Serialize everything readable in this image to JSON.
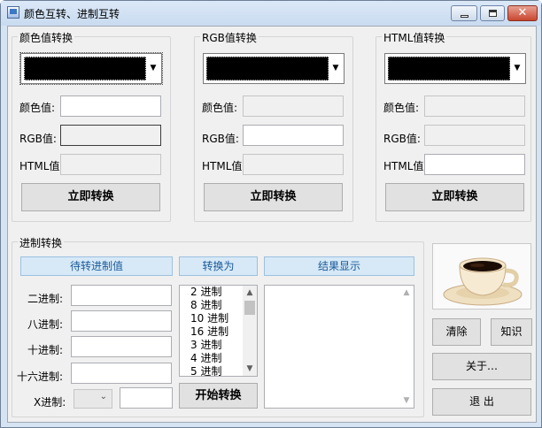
{
  "window": {
    "title": "颜色互转、进制互转",
    "controls": {
      "close": "✕"
    }
  },
  "color_groups": [
    {
      "title": "颜色值转换",
      "swatch_color": "#000000",
      "fields": [
        {
          "label": "颜色值:",
          "value": ""
        },
        {
          "label": "RGB值:",
          "value": ""
        },
        {
          "label": "HTML值:",
          "value": ""
        }
      ],
      "button": "立即转换"
    },
    {
      "title": "RGB值转换",
      "swatch_color": "#000000",
      "fields": [
        {
          "label": "颜色值:",
          "value": ""
        },
        {
          "label": "RGB值:",
          "value": ""
        },
        {
          "label": "HTML值:",
          "value": ""
        }
      ],
      "button": "立即转换"
    },
    {
      "title": "HTML值转换",
      "swatch_color": "#000000",
      "fields": [
        {
          "label": "颜色值:",
          "value": ""
        },
        {
          "label": "RGB值:",
          "value": ""
        },
        {
          "label": "HTML值:",
          "value": ""
        }
      ],
      "button": "立即转换"
    }
  ],
  "base_convert": {
    "title": "进制转换",
    "headers": {
      "input": "待转进制值",
      "target": "转换为",
      "result": "结果显示"
    },
    "inputs": [
      {
        "label": "二进制:",
        "value": ""
      },
      {
        "label": "八进制:",
        "value": ""
      },
      {
        "label": "十进制:",
        "value": ""
      },
      {
        "label": "十六进制:",
        "value": ""
      }
    ],
    "custom": {
      "label": "X进制:",
      "base_value": "",
      "value": ""
    },
    "target_options": [
      "2 进制",
      "8 进制",
      "10 进制",
      "16 进制",
      "3 进制",
      "4 进制",
      "5 进制"
    ],
    "start_button": "开始转换",
    "result_text": ""
  },
  "side_buttons": {
    "clear": "清除",
    "knowledge": "知识",
    "about": "关于…",
    "exit": "退 出"
  },
  "colors": {
    "accent_header": "#d7e9f7",
    "accent_text": "#1a5a9a"
  }
}
